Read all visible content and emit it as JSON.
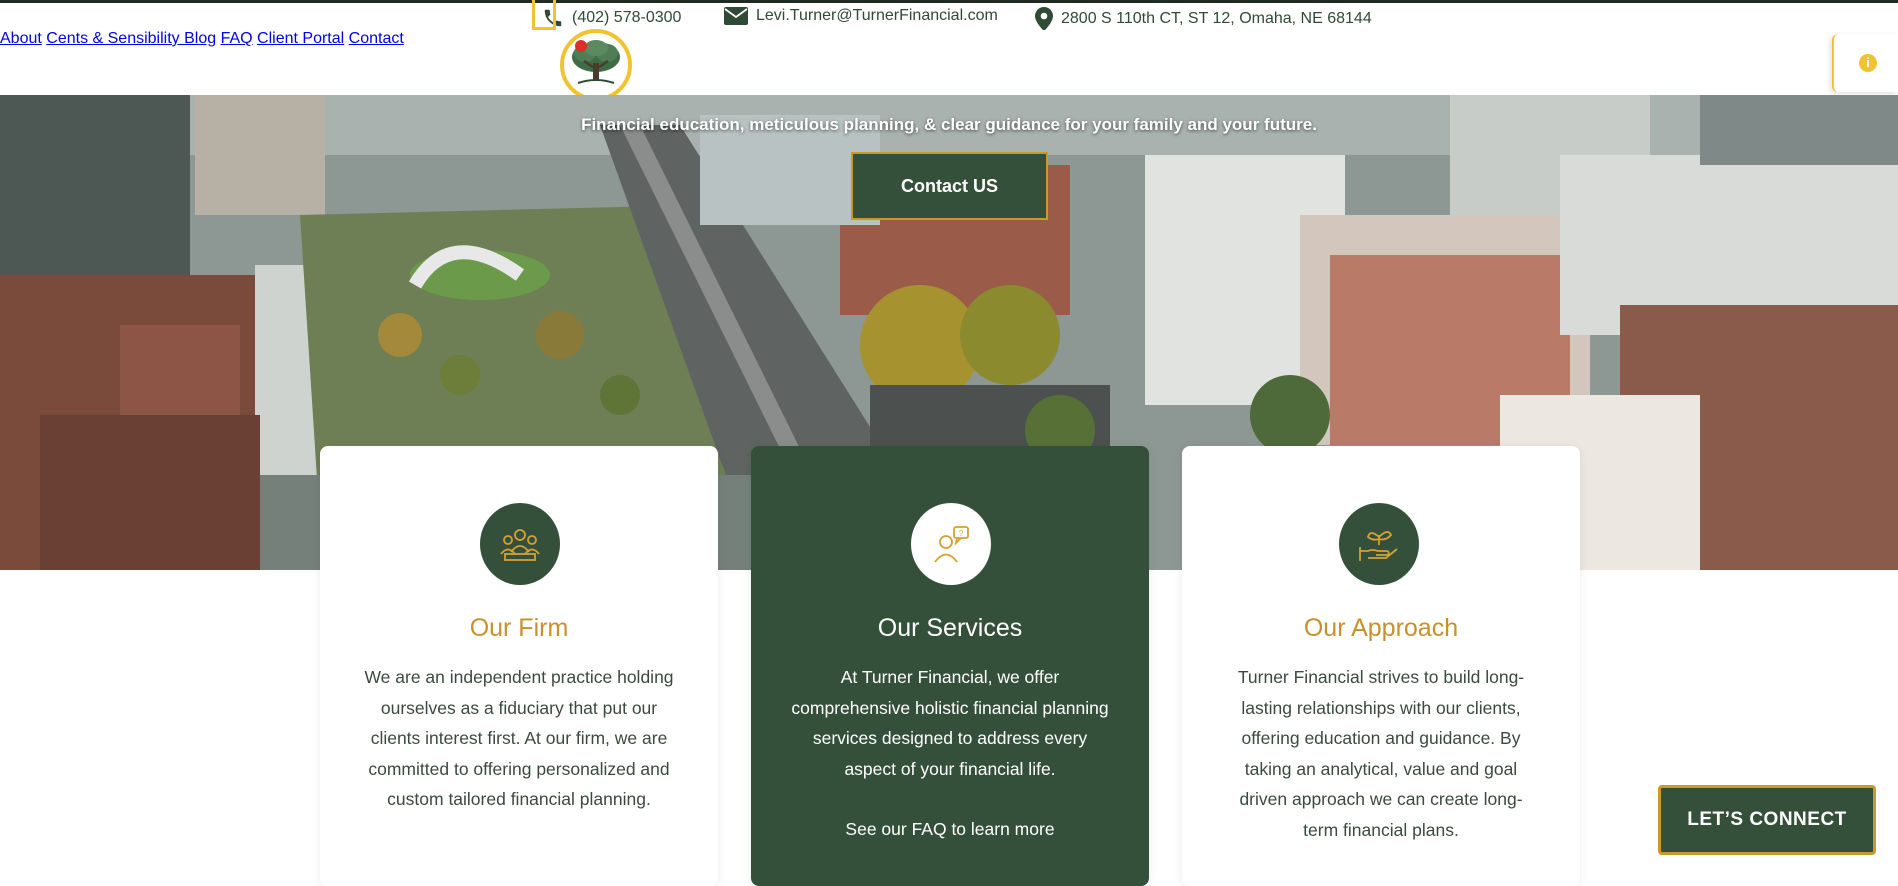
{
  "contact_bar": {
    "phone": "(402) 578-0300",
    "email": "Levi.Turner@TurnerFinancial.com",
    "address": "2800 S 110th CT, ST 12, Omaha, NE 68144"
  },
  "nav": {
    "items": [
      "About",
      "Cents & Sensibility Blog",
      "FAQ",
      "Client Portal",
      "Contact"
    ]
  },
  "hero": {
    "tagline": "Financial education, meticulous planning, & clear guidance for your family and your future.",
    "button_label": "Contact US"
  },
  "cards": [
    {
      "title": "Our Firm",
      "body": "We are an independent practice holding ourselves as a fiduciary that put our clients interest first. At our firm, we are committed to offering personalized and custom tailored financial planning.",
      "icon": "team-icon"
    },
    {
      "title": "Our Services",
      "body": "At Turner Financial, we offer comprehensive holistic financial planning services designed to address every aspect of your financial life.",
      "link": "See our FAQ to learn more",
      "icon": "advisor-chat-icon"
    },
    {
      "title": "Our Approach",
      "body": "Turner Financial strives to build long-lasting relationships with our clients, offering education and guidance. By taking an analytical, value and goal driven approach we can create long-term financial plans.",
      "icon": "hand-plant-icon"
    }
  ],
  "connect_button": "LET’S CONNECT",
  "colors": {
    "brand_green": "#35503a",
    "accent_gold": "#c89a2a",
    "logo_ring": "#f1c232"
  }
}
